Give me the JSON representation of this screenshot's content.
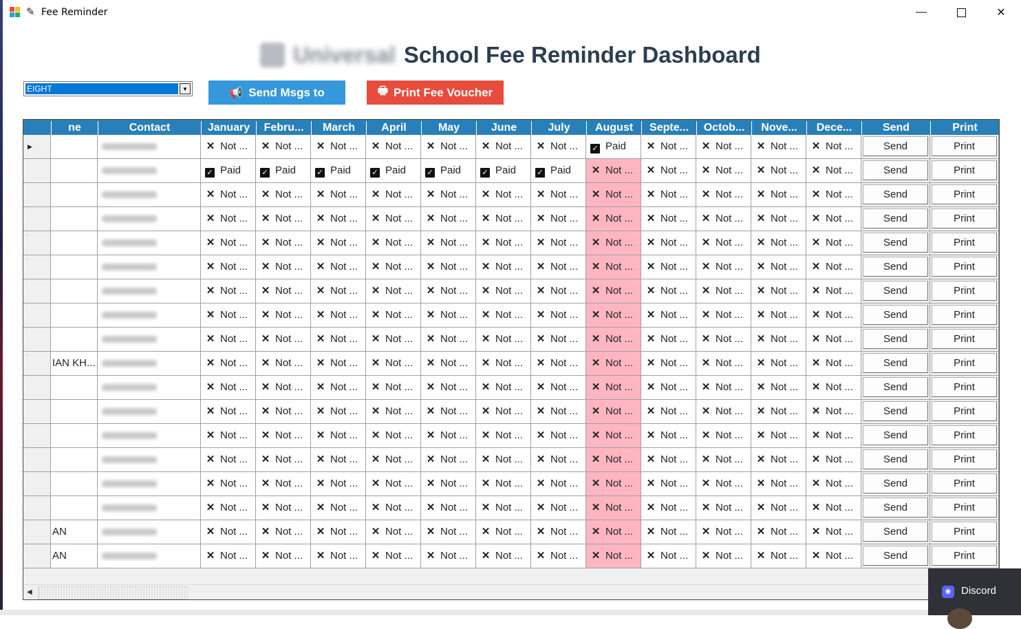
{
  "window": {
    "title": "Fee Reminder"
  },
  "header": {
    "blurred_brand": "Universal",
    "title": "School Fee Reminder Dashboard"
  },
  "controls": {
    "class_select": "EIGHT",
    "send_button": "Send Msgs to",
    "print_button": "Print Fee Voucher"
  },
  "colors": {
    "header_blue": "#2980b9",
    "send_blue": "#3498db",
    "print_red": "#e74c3c",
    "august_highlight": "#ffb6c1"
  },
  "grid": {
    "columns": [
      "ne",
      "Contact",
      "January",
      "Febru...",
      "March",
      "April",
      "May",
      "June",
      "July",
      "August",
      "Septe...",
      "Octob...",
      "Nove...",
      "Dece...",
      "Send",
      "Print"
    ],
    "paid_label": "Paid",
    "not_paid_label": "Not ...",
    "send_label": "Send",
    "print_label": "Print",
    "rows": [
      {
        "name": "",
        "fees": [
          0,
          0,
          0,
          0,
          0,
          0,
          0,
          1,
          0,
          0,
          0,
          0
        ]
      },
      {
        "name": "",
        "fees": [
          1,
          1,
          1,
          1,
          1,
          1,
          1,
          0,
          0,
          0,
          0,
          0
        ]
      },
      {
        "name": "",
        "fees": [
          0,
          0,
          0,
          0,
          0,
          0,
          0,
          0,
          0,
          0,
          0,
          0
        ]
      },
      {
        "name": "",
        "fees": [
          0,
          0,
          0,
          0,
          0,
          0,
          0,
          0,
          0,
          0,
          0,
          0
        ]
      },
      {
        "name": "",
        "fees": [
          0,
          0,
          0,
          0,
          0,
          0,
          0,
          0,
          0,
          0,
          0,
          0
        ]
      },
      {
        "name": "",
        "fees": [
          0,
          0,
          0,
          0,
          0,
          0,
          0,
          0,
          0,
          0,
          0,
          0
        ]
      },
      {
        "name": "",
        "fees": [
          0,
          0,
          0,
          0,
          0,
          0,
          0,
          0,
          0,
          0,
          0,
          0
        ]
      },
      {
        "name": "",
        "fees": [
          0,
          0,
          0,
          0,
          0,
          0,
          0,
          0,
          0,
          0,
          0,
          0
        ]
      },
      {
        "name": "",
        "fees": [
          0,
          0,
          0,
          0,
          0,
          0,
          0,
          0,
          0,
          0,
          0,
          0
        ]
      },
      {
        "name": "IAN KH...",
        "fees": [
          0,
          0,
          0,
          0,
          0,
          0,
          0,
          0,
          0,
          0,
          0,
          0
        ]
      },
      {
        "name": "",
        "fees": [
          0,
          0,
          0,
          0,
          0,
          0,
          0,
          0,
          0,
          0,
          0,
          0
        ]
      },
      {
        "name": "",
        "fees": [
          0,
          0,
          0,
          0,
          0,
          0,
          0,
          0,
          0,
          0,
          0,
          0
        ]
      },
      {
        "name": "",
        "fees": [
          0,
          0,
          0,
          0,
          0,
          0,
          0,
          0,
          0,
          0,
          0,
          0
        ]
      },
      {
        "name": "",
        "fees": [
          0,
          0,
          0,
          0,
          0,
          0,
          0,
          0,
          0,
          0,
          0,
          0
        ]
      },
      {
        "name": "",
        "fees": [
          0,
          0,
          0,
          0,
          0,
          0,
          0,
          0,
          0,
          0,
          0,
          0
        ]
      },
      {
        "name": "",
        "fees": [
          0,
          0,
          0,
          0,
          0,
          0,
          0,
          0,
          0,
          0,
          0,
          0
        ]
      },
      {
        "name": "AN",
        "fees": [
          0,
          0,
          0,
          0,
          0,
          0,
          0,
          0,
          0,
          0,
          0,
          0
        ]
      },
      {
        "name": "AN",
        "fees": [
          0,
          0,
          0,
          0,
          0,
          0,
          0,
          0,
          0,
          0,
          0,
          0
        ]
      }
    ]
  },
  "notification": {
    "app": "Discord"
  }
}
